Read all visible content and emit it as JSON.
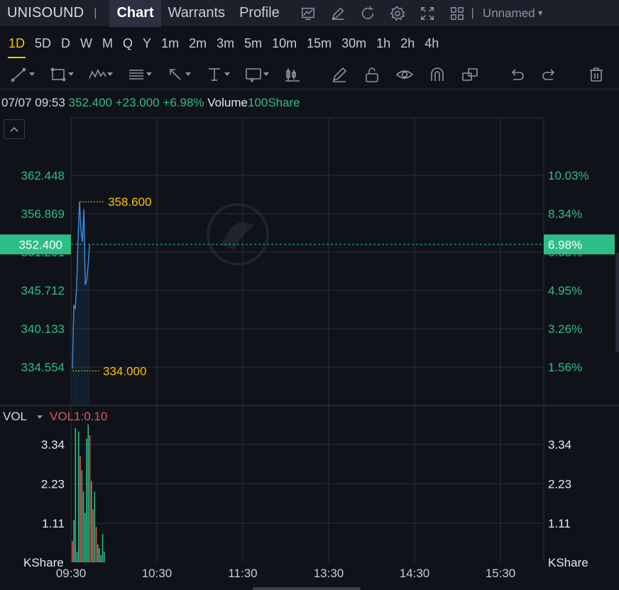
{
  "header": {
    "symbol": "UNISOUND",
    "separator": "|",
    "tabs": [
      {
        "label": "Chart",
        "active": true
      },
      {
        "label": "Warrants",
        "active": false
      },
      {
        "label": "Profile",
        "active": false
      }
    ],
    "icons": [
      "indicator-chart-icon",
      "draw-pen-icon",
      "refresh-icon",
      "settings-gear-icon",
      "fullscreen-icon",
      "grid-layout-icon"
    ],
    "layout_name": "Unnamed"
  },
  "periods": [
    "1D",
    "5D",
    "D",
    "W",
    "M",
    "Q",
    "Y",
    "1m",
    "2m",
    "3m",
    "5m",
    "10m",
    "15m",
    "30m",
    "1h",
    "2h",
    "4h"
  ],
  "active_period": "1D",
  "draw_tools": [
    "trend-line-icon",
    "rectangle-icon",
    "pattern-icon",
    "fib-icon",
    "arrow-icon",
    "text-icon",
    "note-icon",
    "candle-icon",
    "pencil-icon",
    "lock-icon",
    "eye-icon",
    "magnet-icon",
    "layers-icon",
    "undo-icon",
    "redo-icon",
    "trash-icon"
  ],
  "info": {
    "datetime": "07/07 09:53",
    "price": "352.400",
    "change": "+23.000",
    "change_pct": "+6.98%",
    "volume_label": "Volume",
    "volume_value": "100Share"
  },
  "colors": {
    "up": "#2ebd85",
    "down": "#e2564f",
    "accent": "#f5c400",
    "line": "#3b8fe0",
    "grid": "#2a2d38"
  },
  "chart_data": {
    "type": "line",
    "price_axis": [
      "362.448",
      "356.869",
      "351.291",
      "345.712",
      "340.133",
      "334.554"
    ],
    "price_axis_values": [
      362.448,
      356.869,
      351.291,
      345.712,
      340.133,
      334.554
    ],
    "pct_axis": [
      "10.03%",
      "8.34%",
      "6.65%",
      "4.95%",
      "3.26%",
      "1.56%"
    ],
    "current_price_label": "352.400",
    "current_pct_label": "6.98%",
    "current_price": 352.4,
    "high_label": "358.600",
    "high": 358.6,
    "low_label": "334.000",
    "low": 334.0,
    "time_axis": [
      "09:30",
      "10:30",
      "11:30",
      "13:30",
      "14:30",
      "15:30"
    ],
    "price_series": [
      {
        "t": "09:30",
        "v": 334.3
      },
      {
        "t": "09:31",
        "v": 343.6
      },
      {
        "t": "09:32",
        "v": 343.0
      },
      {
        "t": "09:33",
        "v": 346.5
      },
      {
        "t": "09:34",
        "v": 353.5
      },
      {
        "t": "09:35",
        "v": 358.6
      },
      {
        "t": "09:36",
        "v": 354.5
      },
      {
        "t": "09:37",
        "v": 352.8
      },
      {
        "t": "09:38",
        "v": 357.5
      },
      {
        "t": "09:39",
        "v": 346.5
      },
      {
        "t": "09:40",
        "v": 347.2
      },
      {
        "t": "09:41",
        "v": 349.5
      },
      {
        "t": "09:42",
        "v": 352.4
      }
    ],
    "volume_label": "VOL",
    "volume_params": "VOL1:0.10",
    "volume_axis": [
      "3.34",
      "2.23",
      "1.11"
    ],
    "volume_axis_values": [
      3.34,
      2.23,
      1.11
    ],
    "volume_unit": "KShare",
    "volume_series": [
      {
        "v": 0.6,
        "dir": "down"
      },
      {
        "v": 1.2,
        "dir": "up"
      },
      {
        "v": 3.8,
        "dir": "up"
      },
      {
        "v": 0.3,
        "dir": "up"
      },
      {
        "v": 3.7,
        "dir": "up"
      },
      {
        "v": 3.0,
        "dir": "down"
      },
      {
        "v": 2.6,
        "dir": "up"
      },
      {
        "v": 2.0,
        "dir": "up"
      },
      {
        "v": 1.4,
        "dir": "up"
      },
      {
        "v": 3.5,
        "dir": "up"
      },
      {
        "v": 3.9,
        "dir": "up"
      },
      {
        "v": 3.6,
        "dir": "down"
      },
      {
        "v": 2.3,
        "dir": "up"
      },
      {
        "v": 1.5,
        "dir": "down"
      },
      {
        "v": 2.0,
        "dir": "up"
      },
      {
        "v": 1.0,
        "dir": "down"
      },
      {
        "v": 0.5,
        "dir": "up"
      },
      {
        "v": 0.4,
        "dir": "up"
      },
      {
        "v": 0.2,
        "dir": "up"
      },
      {
        "v": 0.8,
        "dir": "up"
      },
      {
        "v": 0.3,
        "dir": "up"
      }
    ]
  }
}
